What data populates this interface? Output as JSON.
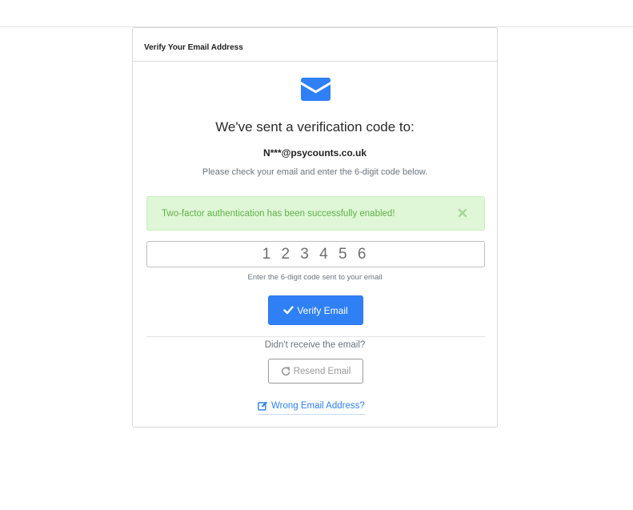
{
  "card": {
    "header_title": "Verify Your Email Address",
    "headline": "We've sent a verification code to:",
    "email": "N***@psycounts.co.uk",
    "instruction": "Please check your email and enter the 6-digit code below."
  },
  "alert": {
    "message": "Two-factor authentication has been successfully enabled!",
    "close_icon": "close-icon",
    "color": "#5fb14a"
  },
  "code_field": {
    "value": "",
    "placeholder": "1 2 3 4 5 6",
    "help": "Enter the 6-digit code sent to your email"
  },
  "actions": {
    "verify_label": "Verify Email",
    "verify_icon": "check-icon",
    "didnt_receive": "Didn't receive the email?",
    "resend_label": "Resend Email",
    "resend_icon": "refresh-icon",
    "wrong_email_label": "Wrong Email Address?",
    "wrong_email_icon": "edit-icon"
  },
  "colors": {
    "primary": "#2f80f5",
    "success_bg": "#dff7d6",
    "muted": "#6c757d"
  }
}
